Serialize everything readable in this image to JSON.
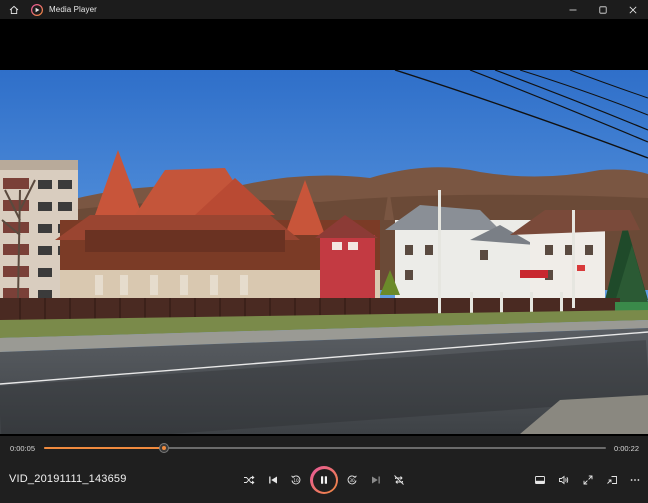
{
  "window": {
    "title": "Media Player",
    "icons": {
      "home": "home-icon",
      "app": "media-player-icon",
      "minimize": "minimize-icon",
      "maximize": "maximize-icon",
      "close": "close-icon"
    }
  },
  "player": {
    "current_time": "0:00:05",
    "duration": "0:00:22",
    "progress": 0.213,
    "file_name": "VID_20191111_143659",
    "accent_colors": {
      "start": "#e7579c",
      "end": "#f08a3e"
    }
  },
  "controls": {
    "left": [
      "shuffle-icon",
      "previous-icon",
      "skip-back-10-icon",
      "pause-icon",
      "skip-forward-30-icon",
      "next-icon",
      "repeat-off-icon"
    ],
    "right": [
      "miniplayer-icon",
      "volume-icon",
      "fullscreen-icon",
      "cast-icon",
      "more-icon"
    ]
  }
}
